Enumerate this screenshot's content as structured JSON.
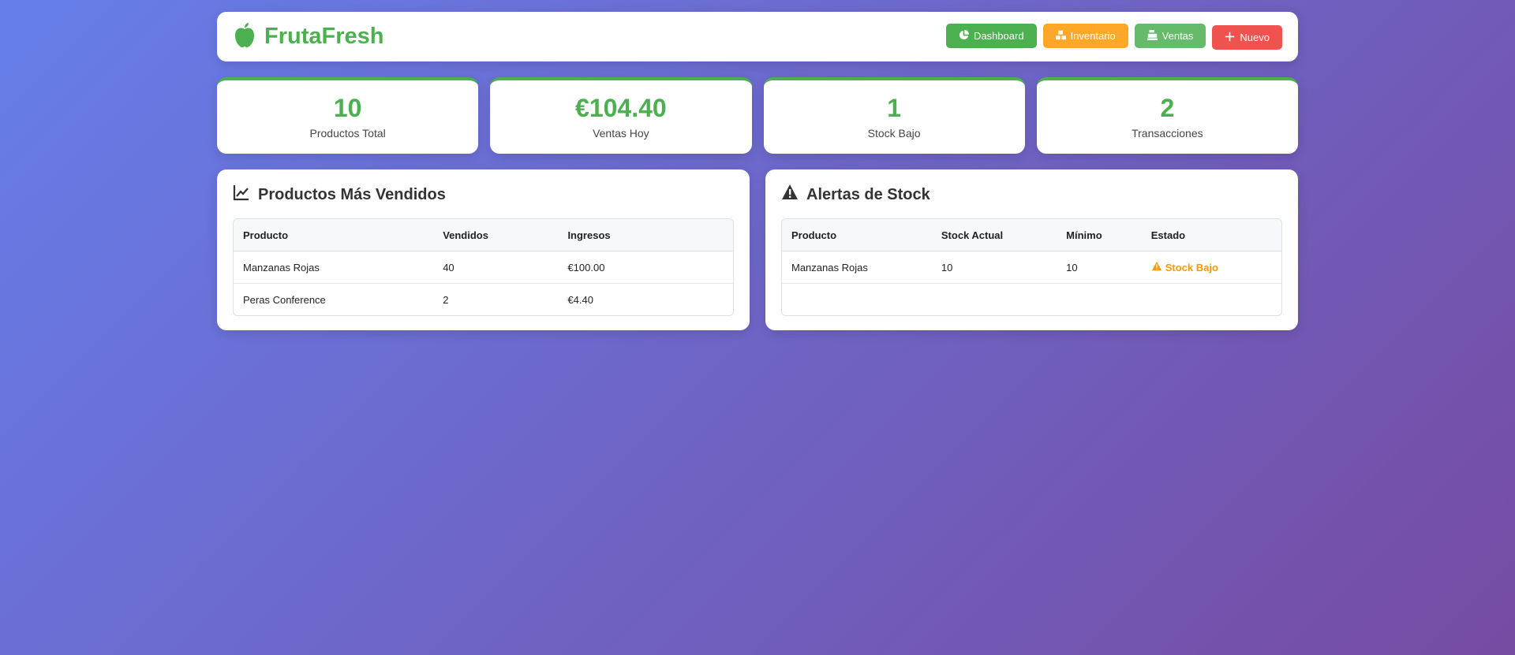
{
  "header": {
    "logo_text": "FrutaFresh",
    "nav": [
      {
        "label": "Dashboard",
        "icon": "chart-pie-icon",
        "color": "#4caf50"
      },
      {
        "label": "Inventario",
        "icon": "boxes-icon",
        "color": "#ffa726"
      },
      {
        "label": "Ventas",
        "icon": "cash-register-icon",
        "color": "#66bb6a"
      },
      {
        "label": "Nuevo",
        "icon": "plus-icon",
        "color": "#ef5350"
      }
    ]
  },
  "stats": [
    {
      "value": "10",
      "label": "Productos Total"
    },
    {
      "value": "€104.40",
      "label": "Ventas Hoy"
    },
    {
      "value": "1",
      "label": "Stock Bajo"
    },
    {
      "value": "2",
      "label": "Transacciones"
    }
  ],
  "top_products": {
    "title": "Productos Más Vendidos",
    "icon": "chart-line-icon",
    "columns": [
      "Producto",
      "Vendidos",
      "Ingresos"
    ],
    "rows": [
      [
        "Manzanas Rojas",
        "40",
        "€100.00"
      ],
      [
        "Peras Conference",
        "2",
        "€4.40"
      ]
    ]
  },
  "stock_alerts": {
    "title": "Alertas de Stock",
    "icon": "warning-icon",
    "columns": [
      "Producto",
      "Stock Actual",
      "Mínimo",
      "Estado"
    ],
    "rows": [
      [
        "Manzanas Rojas",
        "10",
        "10",
        "Stock Bajo"
      ]
    ]
  },
  "colors": {
    "primary": "#4caf50",
    "warning": "#ff9800",
    "danger": "#ef5350"
  }
}
